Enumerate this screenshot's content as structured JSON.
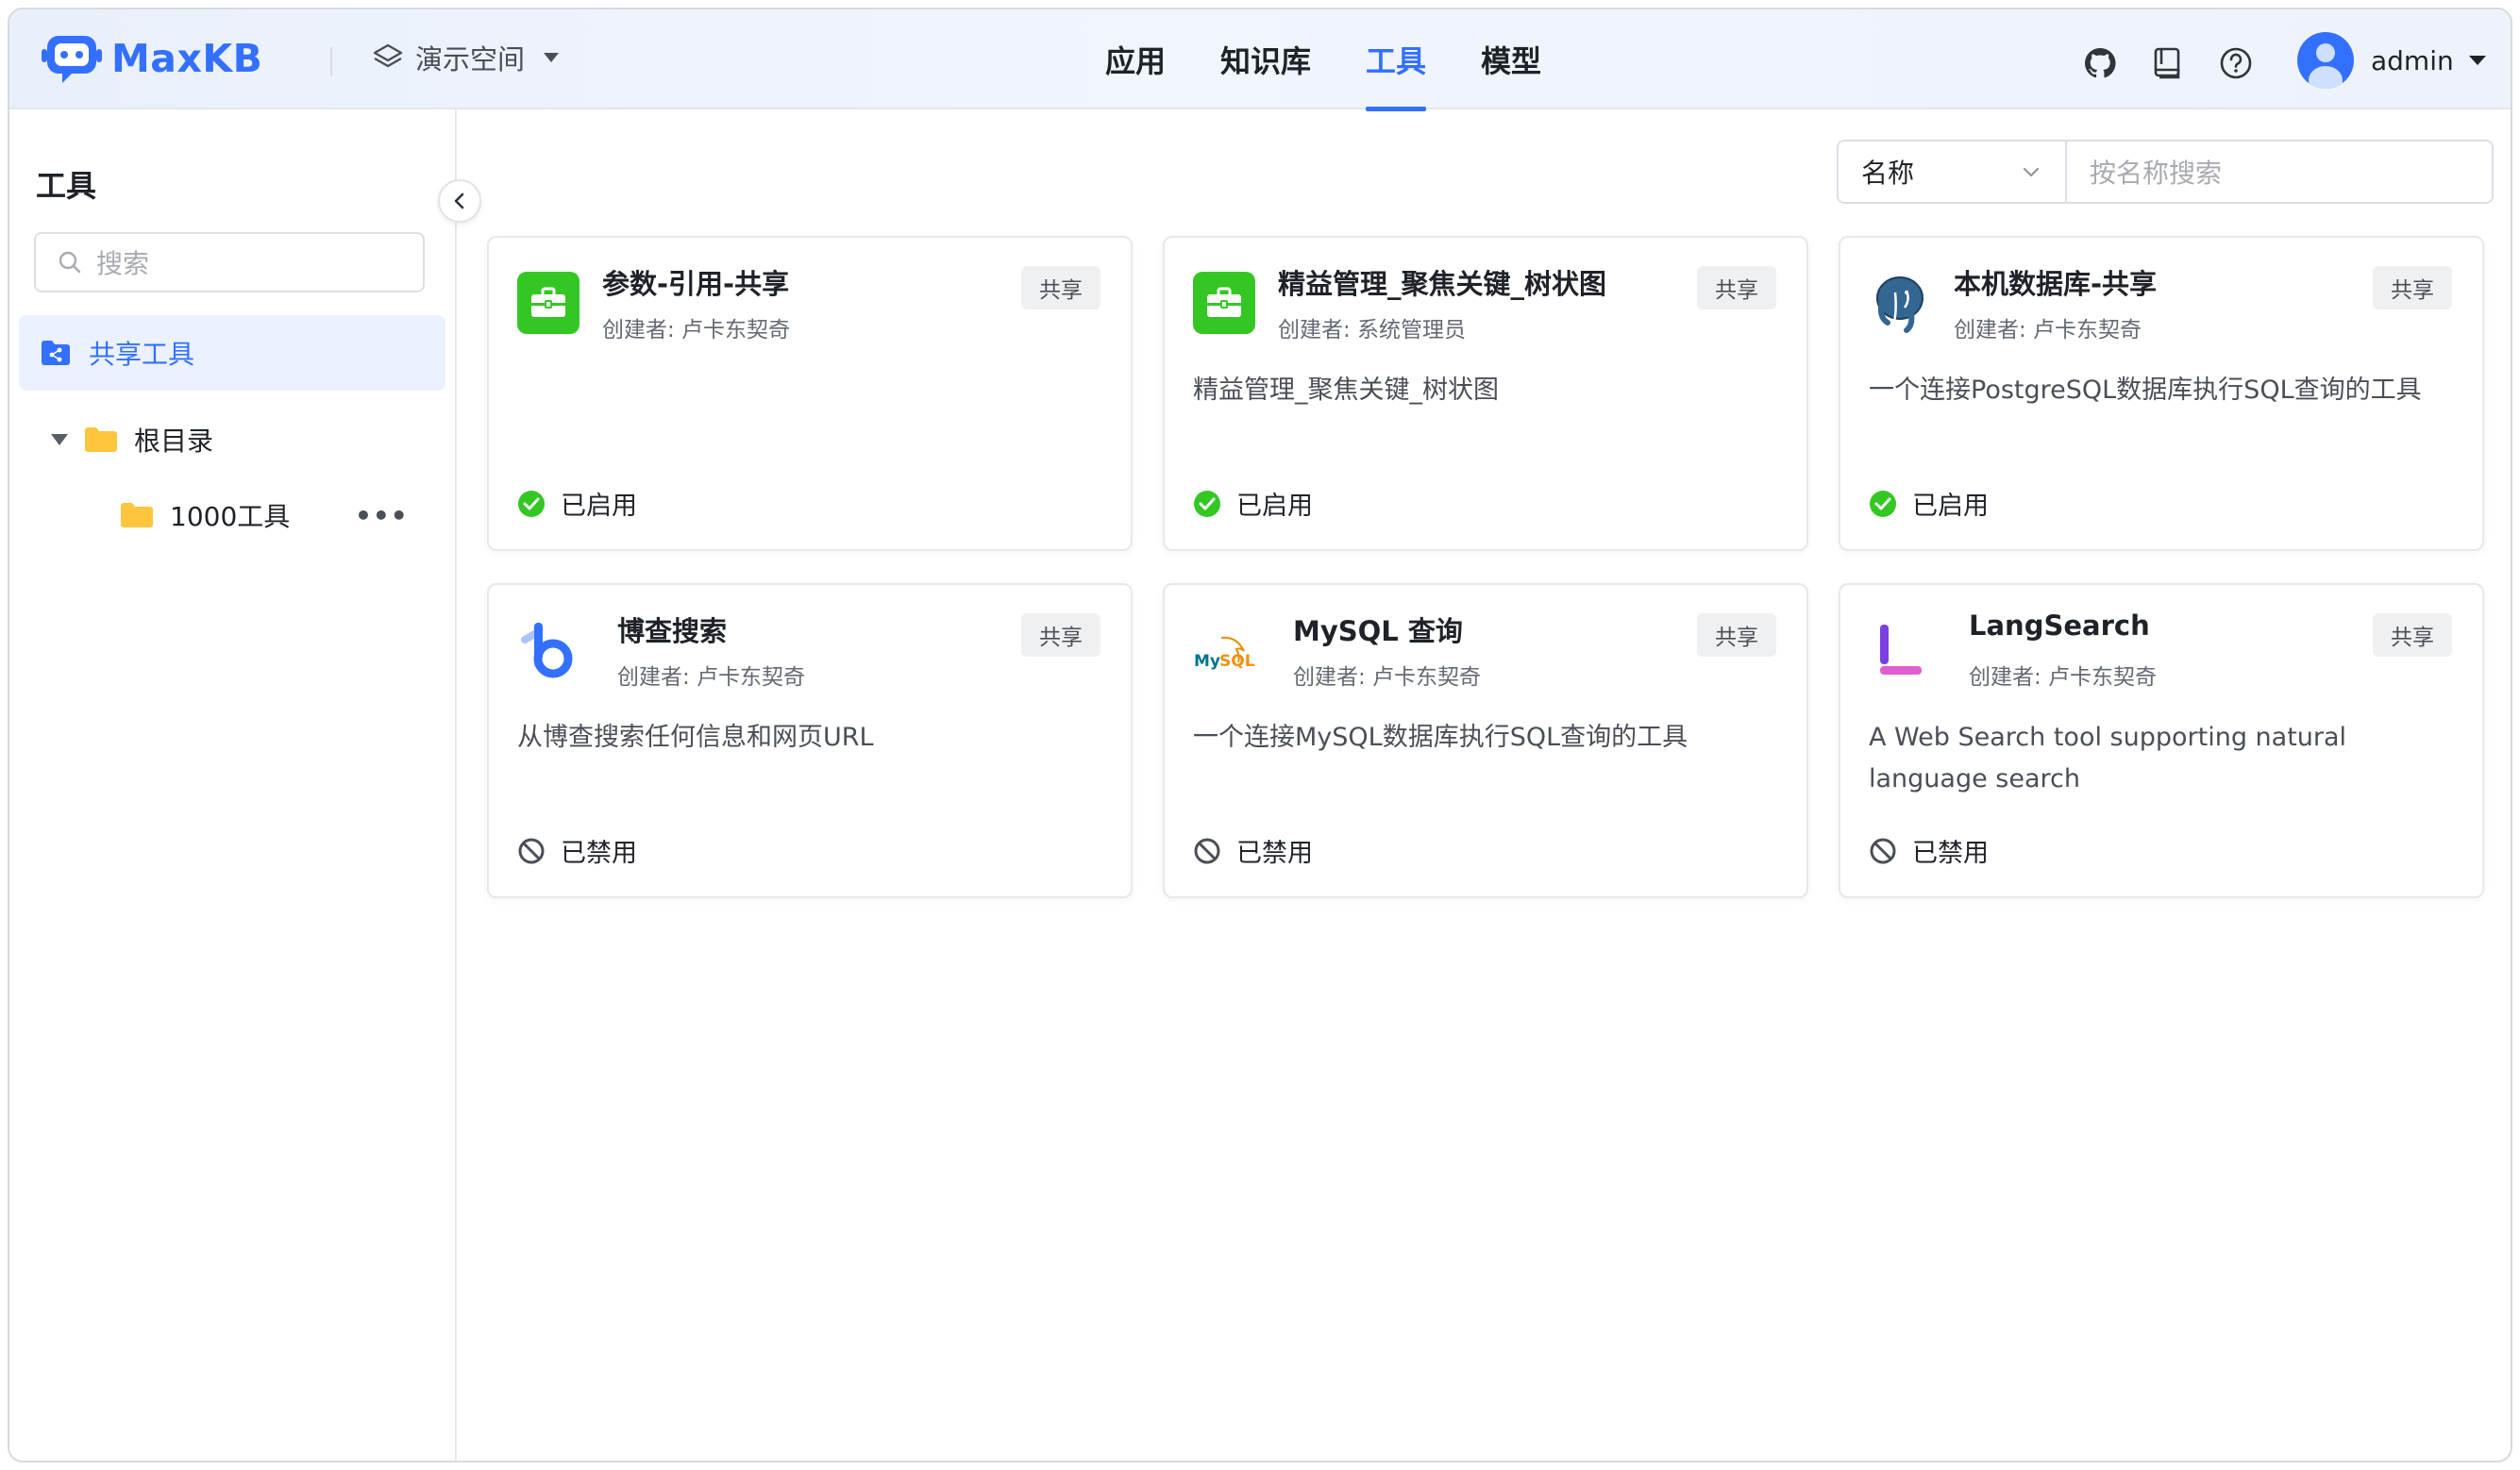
{
  "header": {
    "logo_text": "MaxKB",
    "workspace": "演示空间",
    "nav": [
      {
        "label": "应用",
        "active": false
      },
      {
        "label": "知识库",
        "active": false
      },
      {
        "label": "工具",
        "active": true
      },
      {
        "label": "模型",
        "active": false
      }
    ],
    "icons": [
      "github-icon",
      "book-icon",
      "help-icon"
    ],
    "user": "admin"
  },
  "sidebar": {
    "title": "工具",
    "search_placeholder": "搜索",
    "shared_item": "共享工具",
    "tree_root": "根目录",
    "tree_child": "1000工具",
    "more": "•••"
  },
  "filter": {
    "select_value": "名称",
    "input_placeholder": "按名称搜索"
  },
  "cards": [
    {
      "title": "参数-引用-共享",
      "creator": "创建者: 卢卡东契奇",
      "badge": "共享",
      "desc": "",
      "status": "已启用",
      "enabled": true,
      "icon": "toolbox-icon"
    },
    {
      "title": "精益管理_聚焦关键_树状图",
      "creator": "创建者: 系统管理员",
      "badge": "共享",
      "desc": "精益管理_聚焦关键_树状图",
      "status": "已启用",
      "enabled": true,
      "icon": "toolbox-icon"
    },
    {
      "title": "本机数据库-共享",
      "creator": "创建者: 卢卡东契奇",
      "badge": "共享",
      "desc": "一个连接PostgreSQL数据库执行SQL查询的工具",
      "status": "已启用",
      "enabled": true,
      "icon": "postgresql-icon"
    },
    {
      "title": "博查搜索",
      "creator": "创建者: 卢卡东契奇",
      "badge": "共享",
      "desc": "从博查搜索任何信息和网页URL",
      "status": "已禁用",
      "enabled": false,
      "icon": "bocha-icon"
    },
    {
      "title": "MySQL 查询",
      "creator": "创建者: 卢卡东契奇",
      "badge": "共享",
      "desc": "一个连接MySQL数据库执行SQL查询的工具",
      "status": "已禁用",
      "enabled": false,
      "icon": "mysql-icon"
    },
    {
      "title": "LangSearch",
      "creator": "创建者: 卢卡东契奇",
      "badge": "共享",
      "desc": "A Web Search tool supporting natural language search",
      "status": "已禁用",
      "enabled": false,
      "icon": "langsearch-icon"
    }
  ],
  "colors": {
    "accent": "#3370ff",
    "enabled": "#34c724",
    "text": "#1f2329"
  }
}
